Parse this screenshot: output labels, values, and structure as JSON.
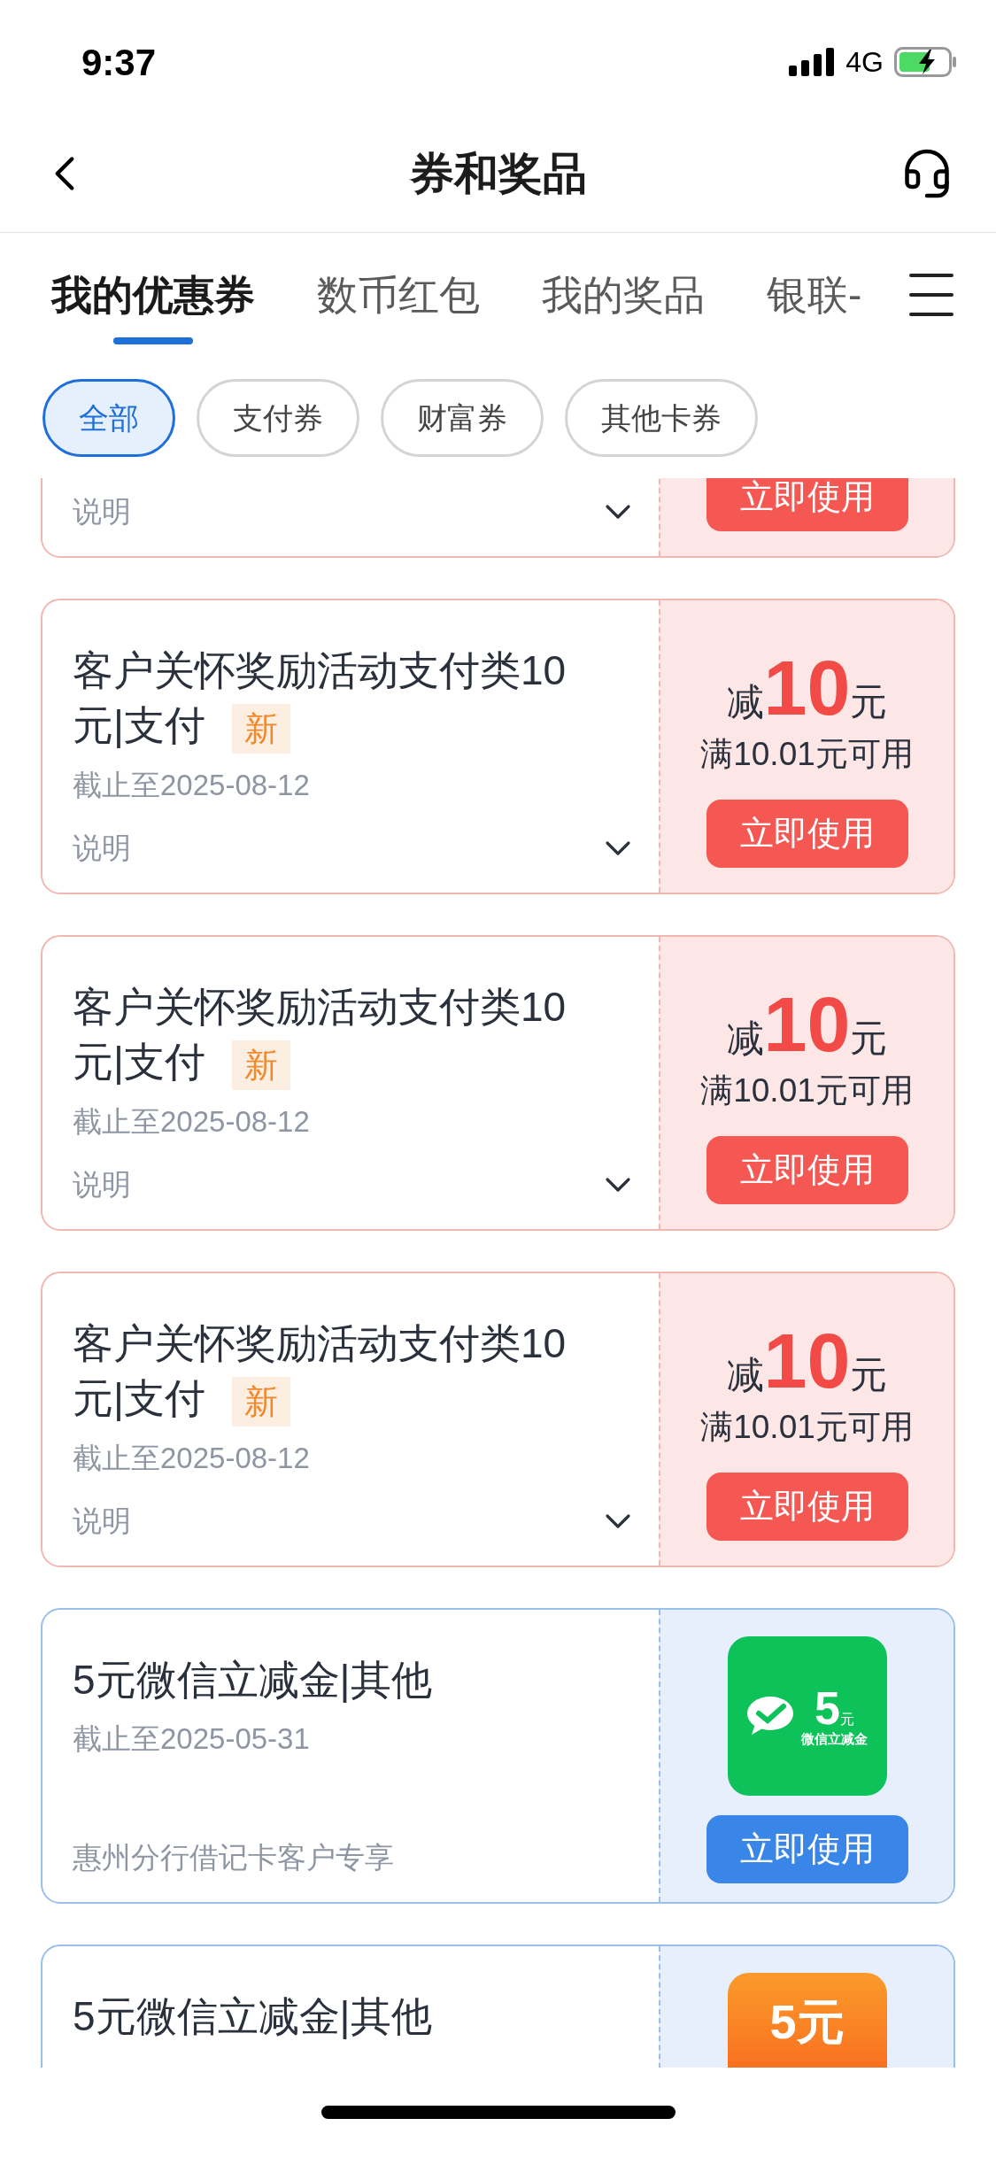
{
  "status_bar": {
    "time": "9:37",
    "network": "4G"
  },
  "header": {
    "title": "券和奖品"
  },
  "tabs": [
    {
      "label": "我的优惠券",
      "selected": true
    },
    {
      "label": "数币红包",
      "selected": false
    },
    {
      "label": "我的奖品",
      "selected": false
    },
    {
      "label": "银联-",
      "selected": false
    }
  ],
  "filters": [
    {
      "label": "全部",
      "selected": true
    },
    {
      "label": "支付券",
      "selected": false
    },
    {
      "label": "财富券",
      "selected": false
    },
    {
      "label": "其他卡券",
      "selected": false
    }
  ],
  "coupons": [
    {
      "kind": "discount",
      "note": "说明",
      "expanded": false,
      "button": "立即使用"
    },
    {
      "kind": "discount",
      "title": "客户关怀奖励活动支付类10元|支付",
      "badge": "新",
      "deadline": "截止至2025-08-12",
      "note": "说明",
      "expanded": false,
      "prefix": "减",
      "amount": "10",
      "unit": "元",
      "condition": "满10.01元可用",
      "button": "立即使用"
    },
    {
      "kind": "discount",
      "title": "客户关怀奖励活动支付类10元|支付",
      "badge": "新",
      "deadline": "截止至2025-08-12",
      "note": "说明",
      "expanded": false,
      "prefix": "减",
      "amount": "10",
      "unit": "元",
      "condition": "满10.01元可用",
      "button": "立即使用"
    },
    {
      "kind": "discount",
      "title": "客户关怀奖励活动支付类10元|支付",
      "badge": "新",
      "deadline": "截止至2025-08-12",
      "note": "说明",
      "expanded": false,
      "prefix": "减",
      "amount": "10",
      "unit": "元",
      "condition": "满10.01元可用",
      "button": "立即使用"
    },
    {
      "kind": "voucher",
      "title": "5元微信立减金|其他",
      "deadline": "截止至2025-05-31",
      "note": "惠州分行借记卡客户专享",
      "image": {
        "kind": "wechat",
        "amount": "5",
        "unit": "元",
        "caption": "微信立减金"
      },
      "button": "立即使用"
    },
    {
      "kind": "voucher",
      "title": "5元微信立减金|其他",
      "image": {
        "kind": "red-packet",
        "label": "5元"
      }
    }
  ]
}
